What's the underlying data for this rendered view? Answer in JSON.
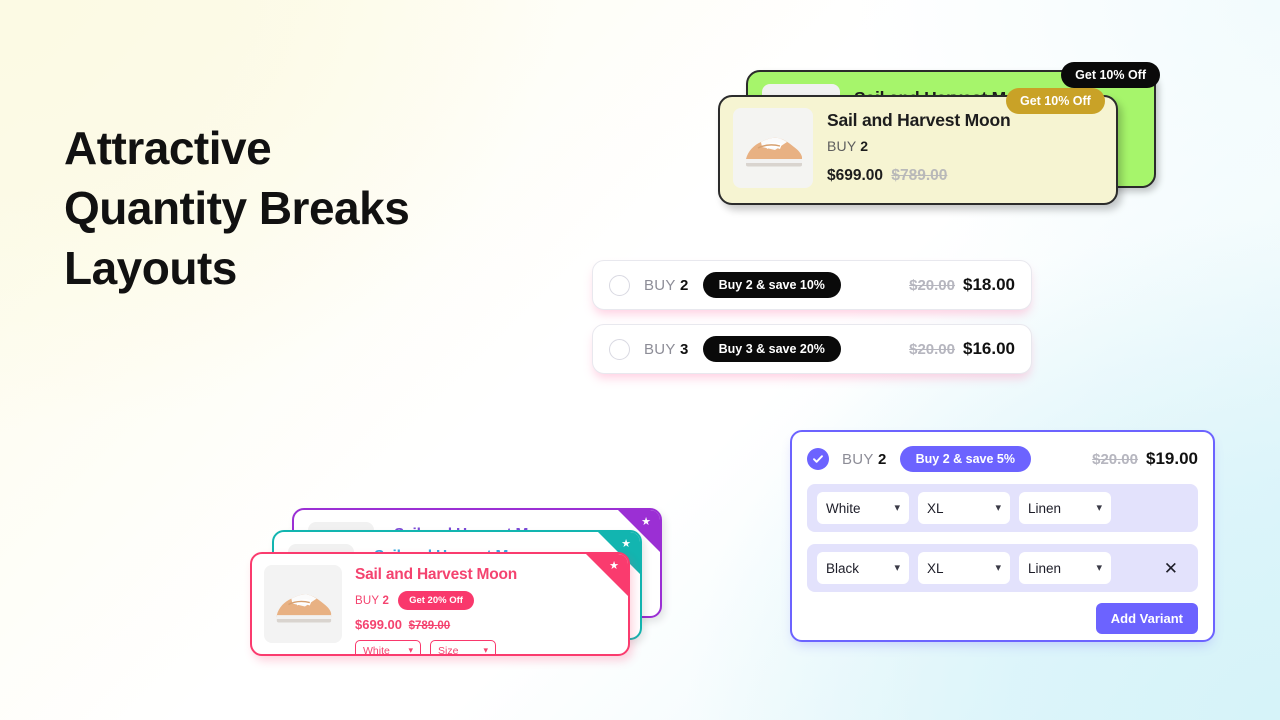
{
  "headline": {
    "line1": "Attractive",
    "line2": "Quantity Breaks",
    "line3": "Layouts"
  },
  "top_stack": {
    "back_card": {
      "title": "Sail and Harvest Moon",
      "badge": "Get 10% Off",
      "bg_color": "#a6f56b"
    },
    "front_card": {
      "title": "Sail and Harvest Moon",
      "buy_label": "BUY",
      "buy_qty": "2",
      "price": "$699.00",
      "old_price": "$789.00",
      "badge": "Get 10% Off",
      "bg_color": "#f6f4d2"
    }
  },
  "radio_rows": [
    {
      "buy_label": "BUY",
      "qty": "2",
      "tag": "Buy 2 & save 10%",
      "old_price": "$20.00",
      "price": "$18.00",
      "selected": false
    },
    {
      "buy_label": "BUY",
      "qty": "3",
      "tag": "Buy 3 & save 20%",
      "old_price": "$20.00",
      "price": "$16.00",
      "selected": false
    }
  ],
  "variant_card": {
    "buy_label": "BUY",
    "qty": "2",
    "tag": "Buy 2 & save 5%",
    "old_price": "$20.00",
    "price": "$19.00",
    "accent_color": "#6c63ff",
    "rows": [
      {
        "color": "White",
        "size": "XL",
        "material": "Linen",
        "removable": false
      },
      {
        "color": "Black",
        "size": "XL",
        "material": "Linen",
        "removable": true
      }
    ],
    "add_variant_label": "Add Variant"
  },
  "bottom_stack": {
    "purple_card": {
      "title": "Sail and Harvest Moon",
      "accent_color": "#9b2fd4"
    },
    "teal_card": {
      "title": "Sail and Harvest Moon",
      "accent_color": "#12b5b0"
    },
    "pink_card": {
      "title": "Sail and Harvest Moon",
      "buy_label": "BUY",
      "qty": "2",
      "tag": "Get 20% Off",
      "price": "$699.00",
      "old_price": "$789.00",
      "color_select": "White",
      "size_select": "Size",
      "accent_color": "#fa3b6e"
    }
  }
}
